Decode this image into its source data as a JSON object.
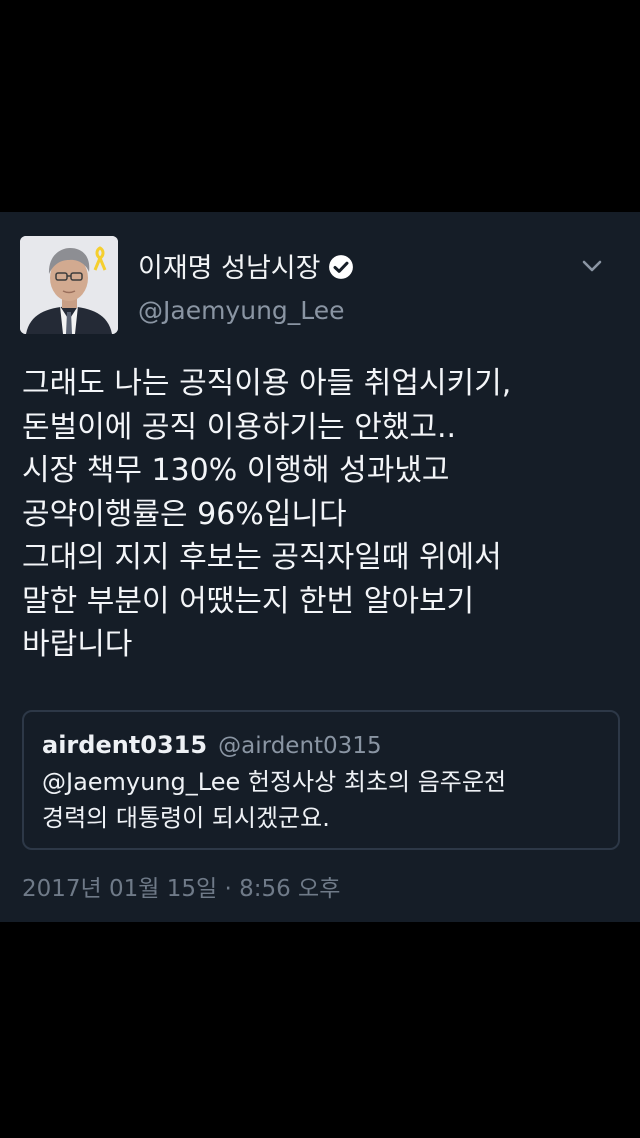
{
  "tweet": {
    "author": {
      "display_name": "이재명 성남시장",
      "handle": "@Jaemyung_Lee",
      "verified_icon": "verified-check-icon"
    },
    "menu_icon": "chevron-down-icon",
    "text_lines": [
      "그래도 나는 공직이용 아들 취업시키기,",
      "돈벌이에 공직 이용하기는 안했고..",
      "시장 책무 130% 이행해 성과냈고",
      "공약이행률은 96%입니다",
      "그대의 지지 후보는 공직자일때 위에서",
      "말한 부분이 어땠는지 한번 알아보기",
      "바랍니다"
    ],
    "quoted_tweet": {
      "display_name": "airdent0315",
      "handle": "@airdent0315",
      "text_lines": [
        "@Jaemyung_Lee 헌정사상 최초의 음주운전",
        "경력의 대통령이 되시겠군요."
      ]
    },
    "timestamp": "2017년 01월 15일 · 8:56 오후"
  },
  "colors": {
    "page_background": "#000000",
    "card_background": "#151d27",
    "primary_text": "#f2f4f6",
    "secondary_text": "#8a95a3",
    "quote_border": "#2d3847"
  }
}
